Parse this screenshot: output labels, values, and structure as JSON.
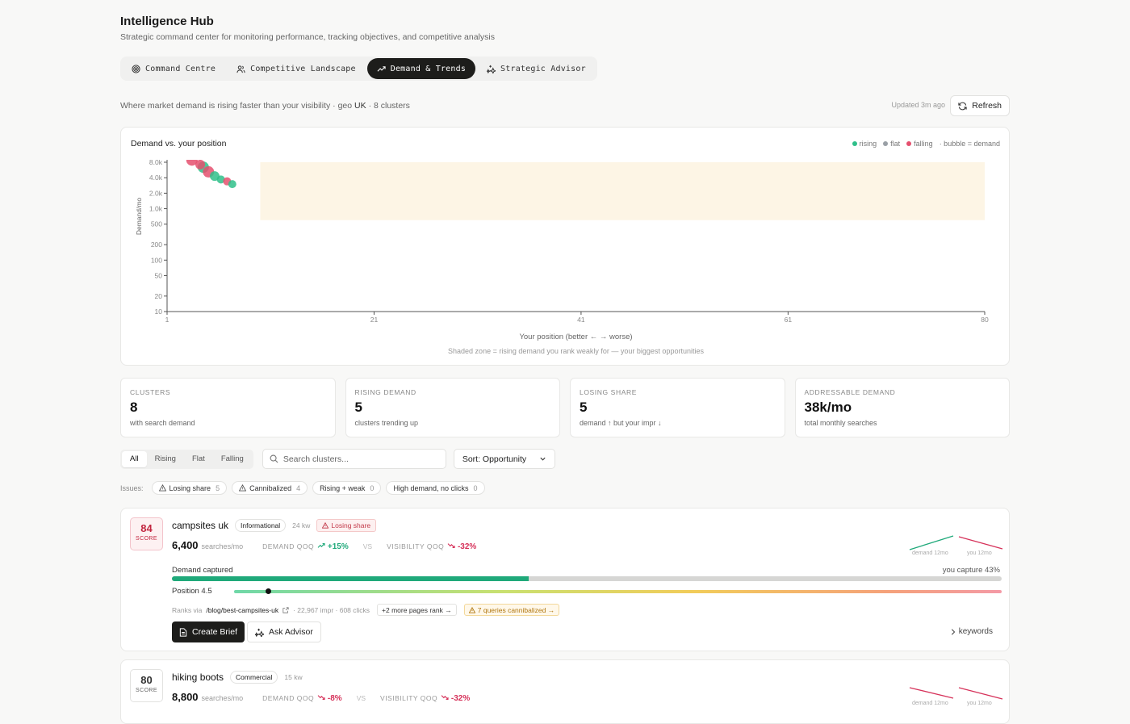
{
  "header": {
    "title": "Intelligence Hub",
    "subtitle": "Strategic command center for monitoring performance, tracking objectives, and competitive analysis"
  },
  "tabs": [
    {
      "label": "Command Centre",
      "icon": "target-icon"
    },
    {
      "label": "Competitive Landscape",
      "icon": "users-icon"
    },
    {
      "label": "Demand & Trends",
      "icon": "trending-up-icon",
      "active": true
    },
    {
      "label": "Strategic Advisor",
      "icon": "sparkles-icon"
    }
  ],
  "meta": {
    "description": "Where market demand is rising faster than your visibility · geo",
    "geo": "UK",
    "clusters_suffix": "· 8 clusters",
    "updated": "Updated 3m ago",
    "refresh_label": "Refresh"
  },
  "chart": {
    "title": "Demand vs. your position",
    "legend": {
      "rising": "rising",
      "flat": "flat",
      "falling": "falling",
      "note": "· bubble = demand"
    },
    "xlabel": "Your position (better ← → worse)",
    "footnote": "Shaded zone = rising demand you rank weakly for — your biggest opportunities"
  },
  "chart_data": {
    "type": "scatter",
    "title": "Demand vs. your position",
    "xlabel": "Your position (better ← → worse)",
    "ylabel": "Demand/mo",
    "y_scale": "log",
    "x_ticks": [
      1,
      21,
      41,
      61,
      80
    ],
    "y_ticks": [
      "10",
      "20",
      "50",
      "100",
      "200",
      "500",
      "1.0k",
      "2.0k",
      "4.0k",
      "8.0k"
    ],
    "xlim": [
      1,
      80
    ],
    "ylim": [
      10,
      8000
    ],
    "colors": {
      "rising": "#2fbf8a",
      "flat": "#9aa0a6",
      "falling": "#e5506e"
    },
    "points": [
      {
        "x": 3.4,
        "y": 8800,
        "trend": "falling",
        "r": 7
      },
      {
        "x": 4.5,
        "y": 6400,
        "trend": "rising",
        "r": 7
      },
      {
        "x": 4.2,
        "y": 7200,
        "trend": "falling",
        "r": 6
      },
      {
        "x": 5.0,
        "y": 5200,
        "trend": "falling",
        "r": 7
      },
      {
        "x": 5.6,
        "y": 4300,
        "trend": "rising",
        "r": 6
      },
      {
        "x": 6.2,
        "y": 3700,
        "trend": "rising",
        "r": 5
      },
      {
        "x": 6.8,
        "y": 3400,
        "trend": "falling",
        "r": 5
      },
      {
        "x": 7.3,
        "y": 3000,
        "trend": "rising",
        "r": 5
      }
    ],
    "opportunity_zone": {
      "x_from": 10,
      "x_to": 80,
      "y_from": 600,
      "y_to": 10000
    },
    "grid": false
  },
  "stats": [
    {
      "label": "CLUSTERS",
      "value": "8",
      "sub": "with search demand"
    },
    {
      "label": "RISING DEMAND",
      "value": "5",
      "sub": "clusters trending up"
    },
    {
      "label": "LOSING SHARE",
      "value": "5",
      "sub": "demand ↑ but your impr ↓"
    },
    {
      "label": "ADDRESSABLE DEMAND",
      "value": "38k/mo",
      "sub": "total monthly searches"
    }
  ],
  "filters": {
    "segments": [
      "All",
      "Rising",
      "Flat",
      "Falling"
    ],
    "active": "All",
    "search_placeholder": "Search clusters...",
    "sort_label": "Sort: Opportunity"
  },
  "issues": {
    "label": "Issues:",
    "items": [
      {
        "label": "Losing share",
        "count": "5",
        "warn": true
      },
      {
        "label": "Cannibalized",
        "count": "4",
        "warn": true
      },
      {
        "label": "Rising + weak",
        "count": "0",
        "warn": false
      },
      {
        "label": "High demand, no clicks",
        "count": "0",
        "warn": false
      }
    ]
  },
  "clusters": [
    {
      "score": "84",
      "score_label": "SCORE",
      "name": "campsites uk",
      "intent": "Informational",
      "kw": "24 kw",
      "badge": "Losing share",
      "searches": "6,400",
      "searches_unit": "searches/mo",
      "demand_label": "DEMAND QOQ",
      "demand_change": "+15%",
      "vs": "VS",
      "visibility_label": "VISIBILITY QOQ",
      "visibility_change": "-32%",
      "spark_demand_label": "demand 12mo",
      "spark_you_label": "you 12mo",
      "captured_label": "Demand captured",
      "capture_text": "you capture 43%",
      "capture_pct": 43,
      "position_label": "Position 4.5",
      "position_value": 4.5,
      "ranks_via": "Ranks via",
      "url": "/blog/best-campsites-uk",
      "url_stats": "· 22,967 impr · 608 clicks",
      "more_pages": "+2 more pages rank →",
      "cannibalized": "7 queries cannibalized →",
      "brief_label": "Create Brief",
      "advisor_label": "Ask Advisor",
      "keywords_label": "keywords"
    },
    {
      "score": "80",
      "score_label": "SCORE",
      "name": "hiking boots",
      "intent": "Commercial",
      "kw": "15 kw",
      "searches": "8,800",
      "searches_unit": "searches/mo",
      "demand_label": "DEMAND QOQ",
      "demand_change": "-8%",
      "vs": "VS",
      "visibility_label": "VISIBILITY QOQ",
      "visibility_change": "-32%",
      "spark_demand_label": "demand 12mo",
      "spark_you_label": "you 12mo"
    }
  ]
}
